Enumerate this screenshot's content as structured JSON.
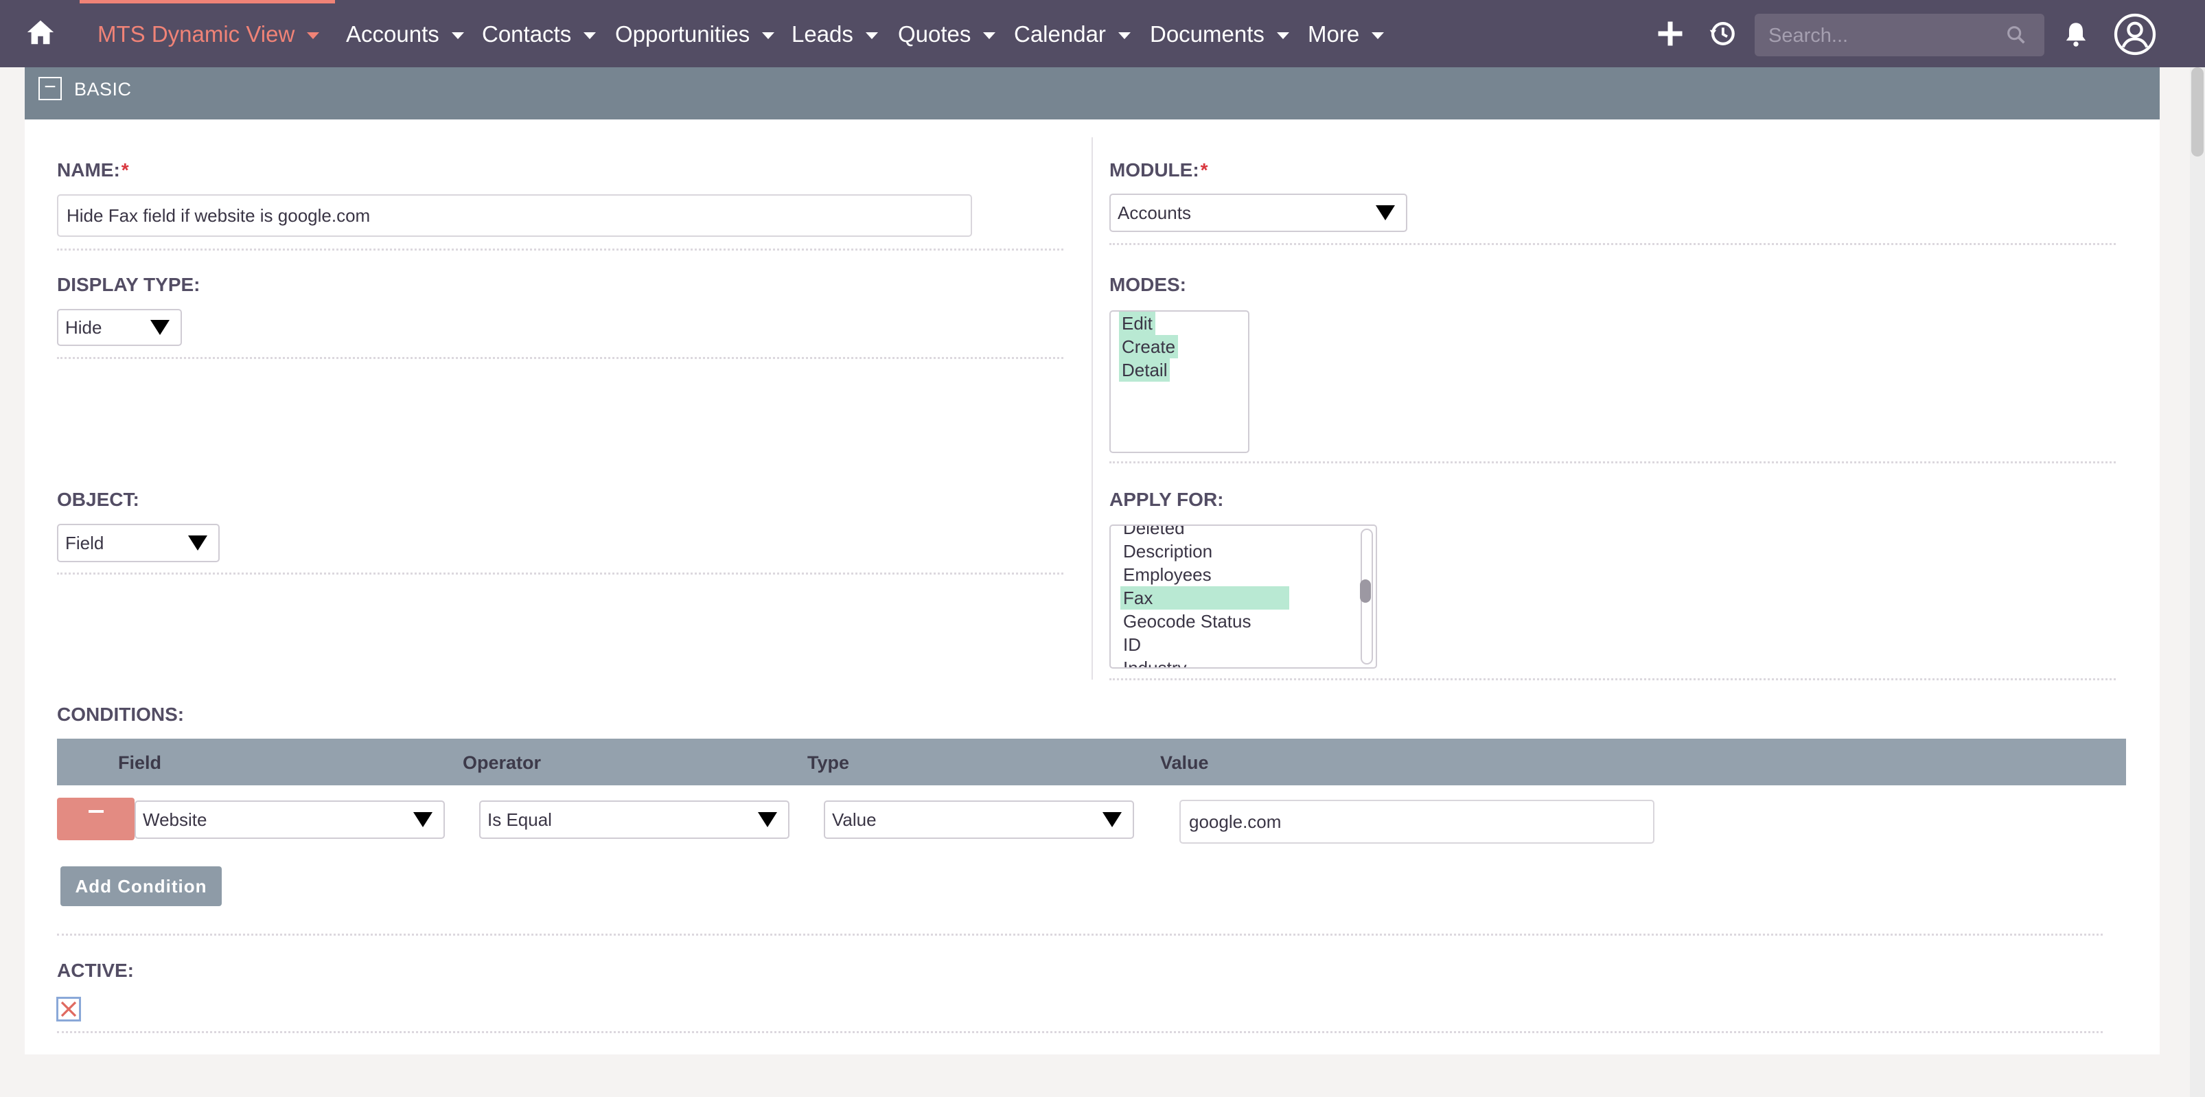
{
  "nav": {
    "home_icon": "home-icon",
    "items": [
      {
        "label": "MTS Dynamic View",
        "active": true
      },
      {
        "label": "Accounts"
      },
      {
        "label": "Contacts"
      },
      {
        "label": "Opportunities"
      },
      {
        "label": "Leads"
      },
      {
        "label": "Quotes"
      },
      {
        "label": "Calendar"
      },
      {
        "label": "Documents"
      },
      {
        "label": "More"
      }
    ],
    "search_placeholder": "Search...",
    "icons": [
      "plus-icon",
      "history-icon",
      "search-icon",
      "bell-icon",
      "user-avatar-icon"
    ]
  },
  "panel": {
    "title": "BASIC",
    "collapse_symbol": "−"
  },
  "form": {
    "name": {
      "label": "NAME:",
      "required": "*",
      "value": "Hide Fax field if website is google.com"
    },
    "module": {
      "label": "MODULE:",
      "required": "*",
      "value": "Accounts"
    },
    "display_type": {
      "label": "DISPLAY TYPE:",
      "value": "Hide"
    },
    "modes": {
      "label": "MODES:",
      "options": [
        "Edit",
        "Create",
        "Detail"
      ],
      "selected": [
        "Edit",
        "Create",
        "Detail"
      ]
    },
    "object": {
      "label": "OBJECT:",
      "value": "Field"
    },
    "apply_for": {
      "label": "APPLY FOR:",
      "options": [
        "Deleted",
        "Description",
        "Employees",
        "Fax",
        "Geocode Status",
        "ID",
        "Industry"
      ],
      "selected": "Fax"
    },
    "conditions": {
      "label": "CONDITIONS:",
      "columns": [
        "Field",
        "Operator",
        "Type",
        "Value"
      ],
      "rows": [
        {
          "field": "Website",
          "operator": "Is Equal",
          "type": "Value",
          "value": "google.com"
        }
      ],
      "add_label": "Add Condition"
    },
    "active": {
      "label": "ACTIVE:",
      "checked": false
    }
  },
  "colors": {
    "nav_bg": "#534d64",
    "accent": "#f08377",
    "panel_header": "#778591",
    "table_header": "#94a1ad",
    "remove_button": "#e38b82",
    "selected_option": "#b9e9d3"
  }
}
